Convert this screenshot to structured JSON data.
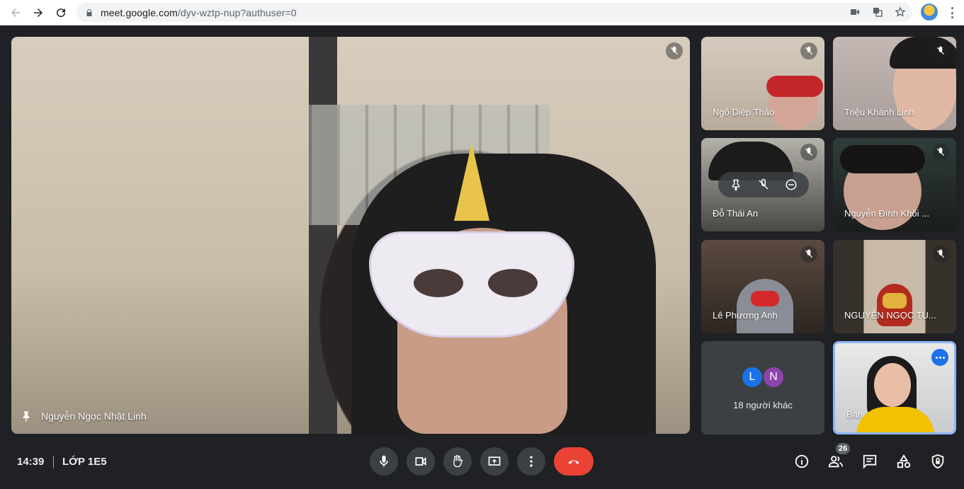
{
  "browser": {
    "url_host": "meet.google.com",
    "url_path": "/dyv-wztp-nup?authuser=0",
    "icons": [
      "back-arrow-icon",
      "forward-arrow-icon",
      "reload-icon",
      "lock-icon",
      "camera-icon",
      "translate-icon",
      "star-icon",
      "profile-avatar",
      "more-vert-icon"
    ]
  },
  "main_speaker": {
    "name": "Nguyễn Ngọc Nhật Linh",
    "pinned": true
  },
  "participants": [
    {
      "name": "Ngô Diệp Thảo",
      "muted": true
    },
    {
      "name": "Triệu Khánh Linh",
      "muted": true
    },
    {
      "name": "Đỗ Thái An",
      "muted": true
    },
    {
      "name": "Nguyễn Đình Khôi ...",
      "muted": true
    },
    {
      "name": "Lê Phương Anh",
      "muted": true
    },
    {
      "name": "NGUYỄN NGỌC TU...",
      "muted": true
    },
    {
      "name": "Ban",
      "muted": false
    }
  ],
  "others": {
    "avatar_letters": [
      "L",
      "N"
    ],
    "label": "18 người khác"
  },
  "meeting": {
    "time": "14:39",
    "code": "LỚP 1E5",
    "participant_count": "26"
  },
  "colors": {
    "background": "#202124",
    "control": "#3c4043",
    "end_call": "#ea4335",
    "highlight": "#8ab4f8",
    "accent": "#1a73e8"
  }
}
